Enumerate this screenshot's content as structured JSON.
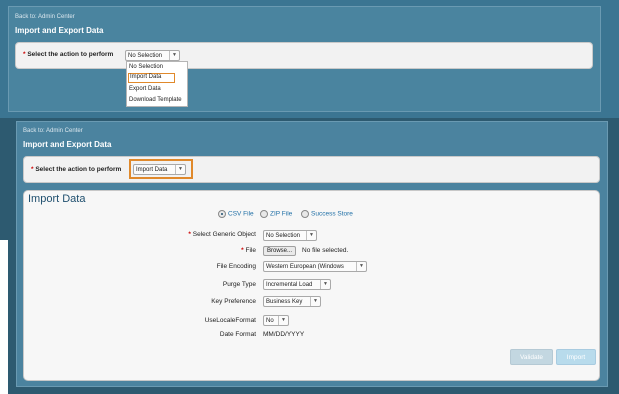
{
  "top_panel": {
    "back_link": "Back to: Admin Center",
    "title": "Import and Export Data",
    "action_label": "Select the action to perform",
    "required_mark": "*",
    "action_value": "No Selection",
    "dropdown_options": [
      "No Selection",
      "Import Data",
      "Export Data",
      "Download Template"
    ]
  },
  "bottom_panel": {
    "back_link": "Back to: Admin Center",
    "title": "Import and Export Data",
    "action_label": "Select the action to perform",
    "required_mark": "*",
    "action_value": "Import Data"
  },
  "import_form": {
    "title": "Import Data",
    "file_types": [
      "CSV File",
      "ZIP File",
      "Success Store"
    ],
    "selected_file_type": "CSV File",
    "fields": {
      "generic_object": {
        "label": "Select Generic Object",
        "value": "No Selection",
        "required": true
      },
      "file": {
        "label": "File",
        "button": "Browse...",
        "status": "No file selected.",
        "required": true
      },
      "encoding": {
        "label": "File Encoding",
        "value": "Western European (Windows"
      },
      "purge_type": {
        "label": "Purge Type",
        "value": "Incremental Load"
      },
      "key_preference": {
        "label": "Key Preference",
        "value": "Business Key"
      },
      "use_locale_format": {
        "label": "UseLocaleFormat",
        "value": "No"
      },
      "date_format": {
        "label": "Date Format",
        "value": "MM/DD/YYYY"
      }
    },
    "buttons": {
      "validate": "Validate",
      "import": "Import"
    }
  },
  "colors": {
    "accent_highlight": "#e0892b",
    "panel_blue": "#4b839f",
    "link_blue": "#1f6fa6"
  }
}
